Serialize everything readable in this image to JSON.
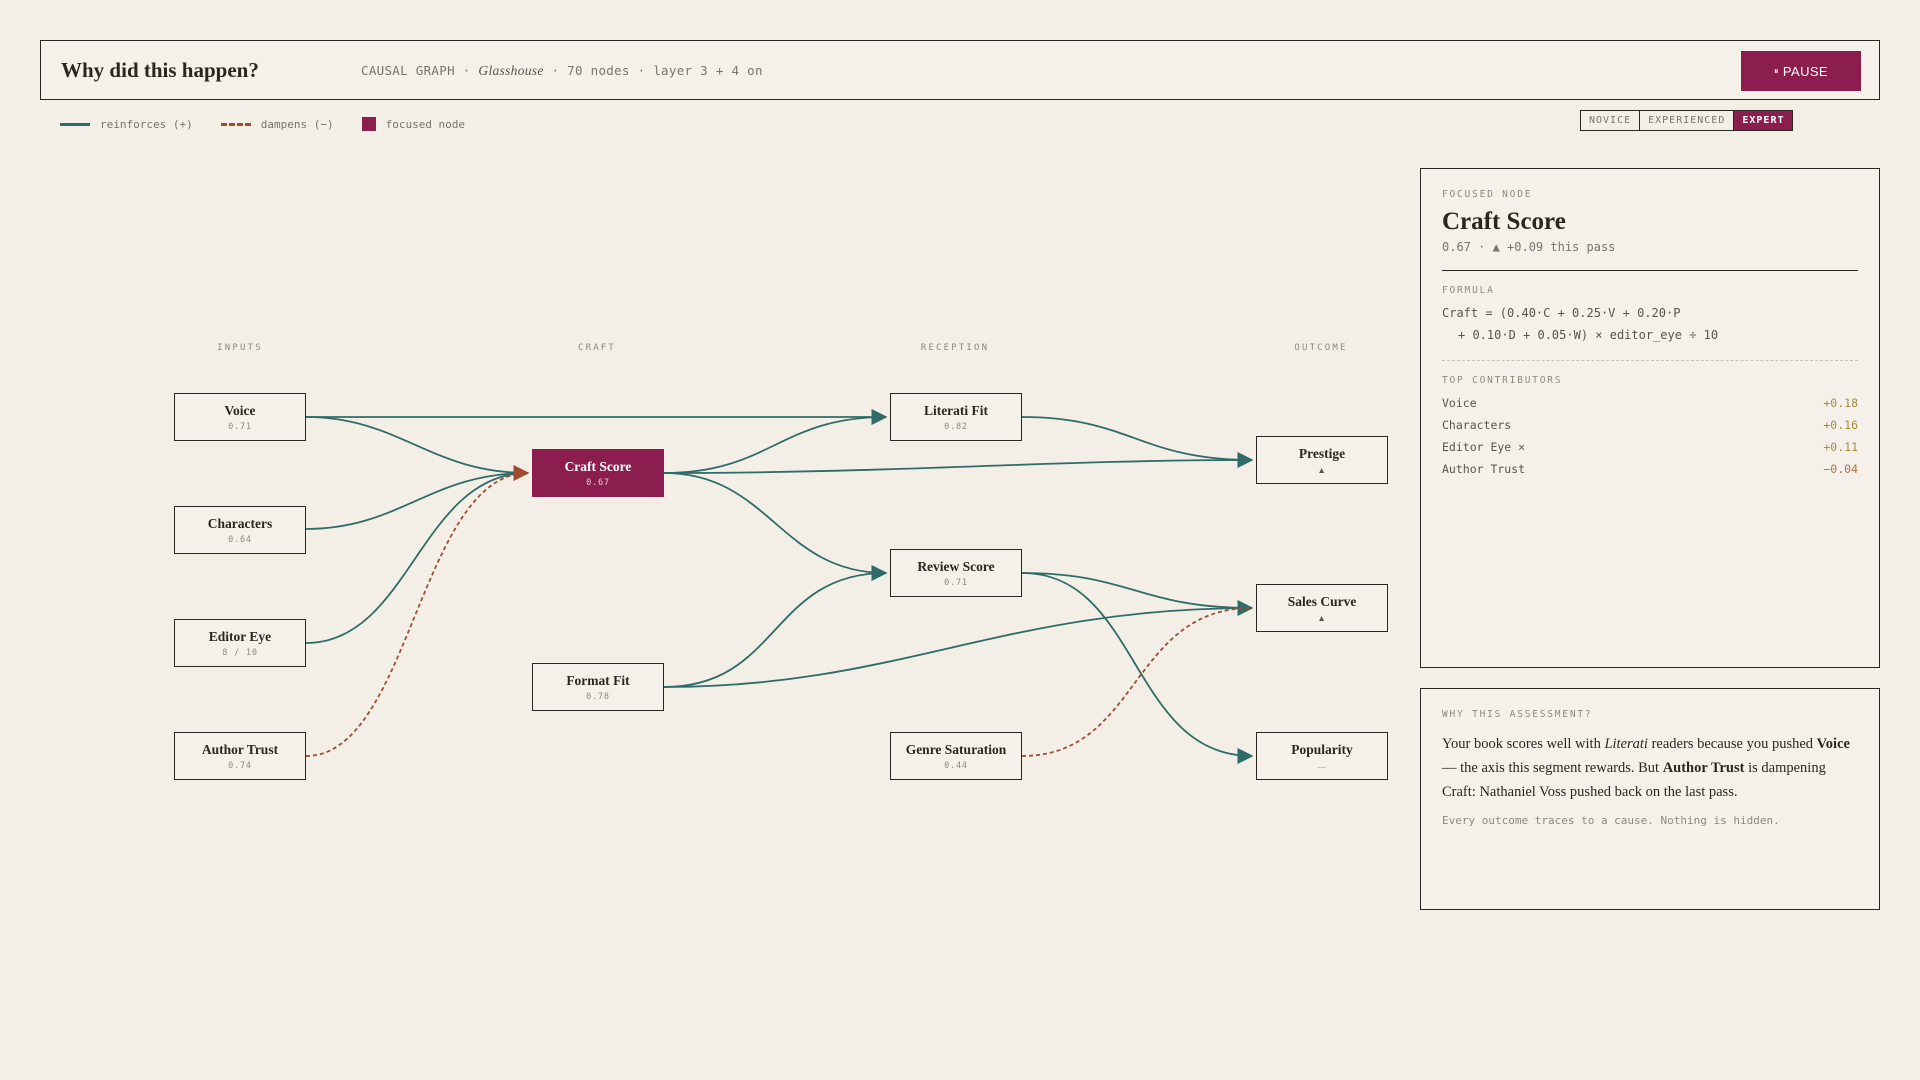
{
  "header": {
    "title": "Why did this happen?",
    "meta_prefix": "CAUSAL GRAPH ·",
    "project": "Glasshouse",
    "meta_suffix": "· 70 nodes · layer 3 + 4 on",
    "pause_icon": "⏸",
    "pause_label": "PAUSE"
  },
  "legend": {
    "reinforces": "reinforces (+)",
    "dampens": "dampens (−)",
    "focused": "focused node"
  },
  "levels": {
    "novice": "NOVICE",
    "experienced": "EXPERIENCED",
    "expert": "EXPERT",
    "selected": "EXPERT"
  },
  "columns": {
    "inputs": "INPUTS",
    "craft": "CRAFT",
    "reception": "RECEPTION",
    "outcome": "OUTCOME"
  },
  "nodes": {
    "voice": {
      "name": "Voice",
      "value": "0.71"
    },
    "characters": {
      "name": "Characters",
      "value": "0.64"
    },
    "editor_eye": {
      "name": "Editor Eye",
      "value": "8 / 10"
    },
    "author_trust": {
      "name": "Author Trust",
      "value": "0.74"
    },
    "craft_score": {
      "name": "Craft Score",
      "value": "0.67"
    },
    "format_fit": {
      "name": "Format Fit",
      "value": "0.78"
    },
    "literati_fit": {
      "name": "Literati Fit",
      "value": "0.82"
    },
    "review_score": {
      "name": "Review Score",
      "value": "0.71"
    },
    "genre_saturation": {
      "name": "Genre Saturation",
      "value": "0.44"
    },
    "prestige": {
      "name": "Prestige",
      "value": "▲"
    },
    "sales_curve": {
      "name": "Sales Curve",
      "value": "▲"
    },
    "popularity": {
      "name": "Popularity",
      "value": "—"
    }
  },
  "colors": {
    "accent": "#8b1e4f",
    "reinforce": "#2f6b68",
    "dampen": "#a14b30"
  },
  "focus_panel": {
    "kicker": "FOCUSED NODE",
    "title": "Craft Score",
    "subtitle": "0.67 · ▲ +0.09 this pass",
    "formula_label": "FORMULA",
    "formula_line1": "Craft = (0.40·C + 0.25·V + 0.20·P",
    "formula_line2": "+ 0.10·D + 0.05·W) × editor_eye ÷ 10",
    "contributors_label": "TOP CONTRIBUTORS",
    "contributors": [
      {
        "name": "Voice",
        "value": "+0.18"
      },
      {
        "name": "Characters",
        "value": "+0.16"
      },
      {
        "name": "Editor Eye ×",
        "value": "+0.11"
      },
      {
        "name": "Author Trust",
        "value": "−0.04"
      }
    ]
  },
  "why_panel": {
    "kicker": "WHY THIS ASSESSMENT?",
    "t1": "Your book scores well with ",
    "t2": "Literati",
    "t3": " readers because you pushed ",
    "t4": "Voice",
    "t5": " — the axis this segment rewards. But ",
    "t6": "Author Trust",
    "t7": " is dampening Craft: Nathaniel Voss pushed back on the last pass.",
    "note": "Every outcome traces to a cause. Nothing is hidden."
  }
}
